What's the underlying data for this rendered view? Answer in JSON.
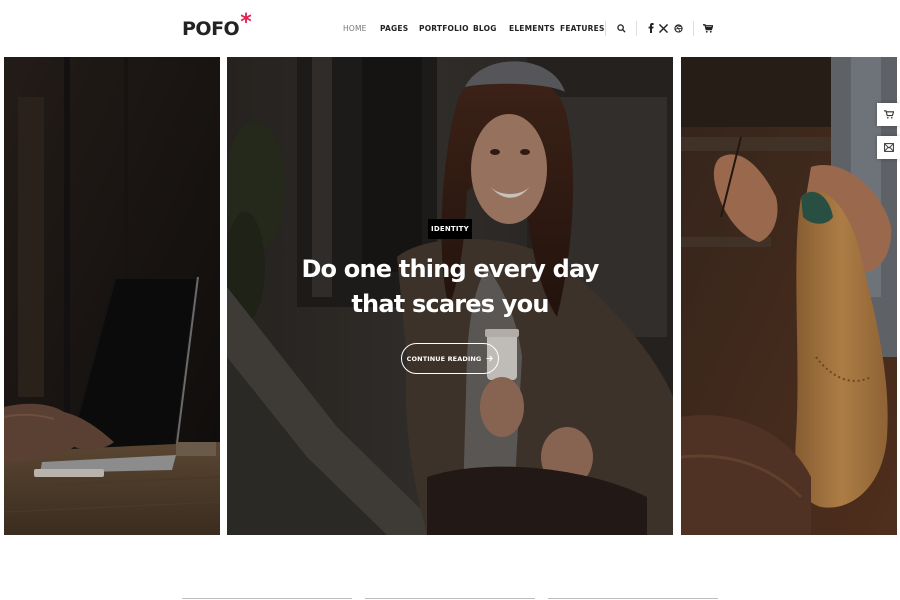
{
  "header": {
    "logo_text": "POFO",
    "logo_mark": "*",
    "nav": [
      {
        "label": "HOME",
        "active": true
      },
      {
        "label": "PAGES"
      },
      {
        "label": "PORTFOLIO"
      },
      {
        "label": "BLOG"
      },
      {
        "label": "ELEMENTS"
      },
      {
        "label": "FEATURES"
      }
    ],
    "icons": [
      "search-icon",
      "facebook-icon",
      "x-icon",
      "dribbble-icon",
      "cart-icon"
    ]
  },
  "hero": {
    "badge": "IDENTITY",
    "headline_line1": "Do one thing every day",
    "headline_line2": "that scares you",
    "cta_label": "CONTINUE READING",
    "cta_icon": "arrow-right-icon"
  },
  "floating_buttons": [
    "cart-icon",
    "mail-icon"
  ],
  "colors": {
    "accent": "#e81e4d",
    "text_dark": "#232323",
    "overlay": "#000000"
  }
}
